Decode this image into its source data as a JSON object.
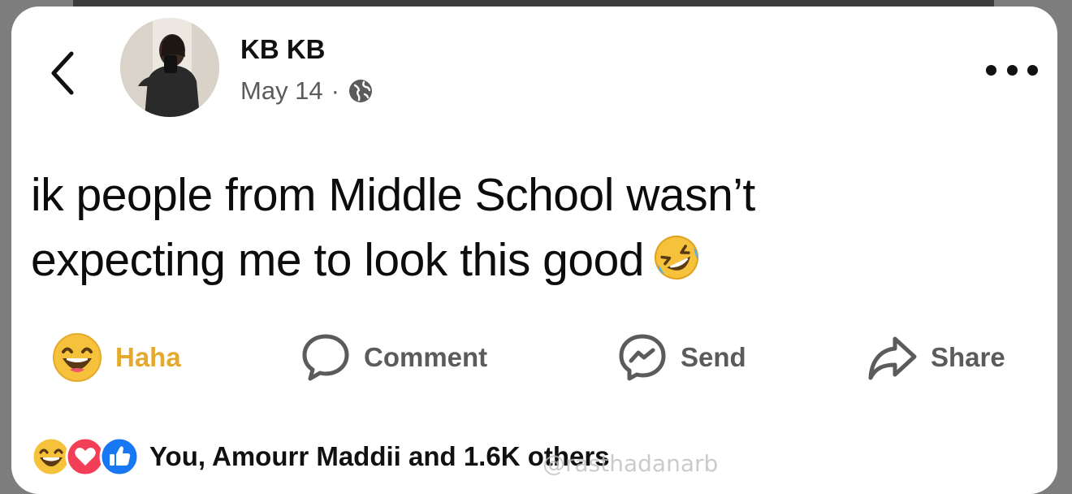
{
  "post": {
    "author": "KB KB",
    "date": "May 14",
    "separator": "·",
    "text_line1": "ik people from Middle School wasn’t",
    "text_line2": "expecting me to look this good"
  },
  "actions": {
    "reaction_label": "Haha",
    "comment_label": "Comment",
    "send_label": "Send",
    "share_label": "Share"
  },
  "reactions": {
    "summary": "You, Amourr Maddii and 1.6K others"
  },
  "watermark": "@rasthadanarb",
  "colors": {
    "haha_label": "#e5a92e",
    "like_blue": "#1877f2",
    "love_red": "#f33e58",
    "muted": "#5b5b5b"
  }
}
